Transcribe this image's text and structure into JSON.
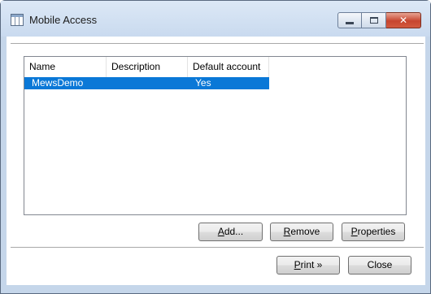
{
  "window": {
    "title": "Mobile Access",
    "close_symbol": "✕"
  },
  "accounts_table": {
    "columns": [
      "Name",
      "Description",
      "Default account"
    ],
    "rows": [
      {
        "name": "MewsDemo",
        "description": "",
        "default_account": "Yes",
        "selected": true
      }
    ]
  },
  "actions": {
    "add": {
      "mnemonic": "A",
      "rest": "dd..."
    },
    "remove": {
      "mnemonic": "R",
      "rest": "emove"
    },
    "properties": {
      "mnemonic": "P",
      "rest": "roperties"
    },
    "print": {
      "mnemonic": "P",
      "rest": "rint »"
    },
    "close": "Close"
  },
  "colors": {
    "selection": "#0a78d7",
    "window_frame": "#c5d6ea",
    "close_button": "#c7452f"
  },
  "icons": [
    "window-app-icon",
    "minimize-icon",
    "maximize-icon",
    "close-icon"
  ]
}
